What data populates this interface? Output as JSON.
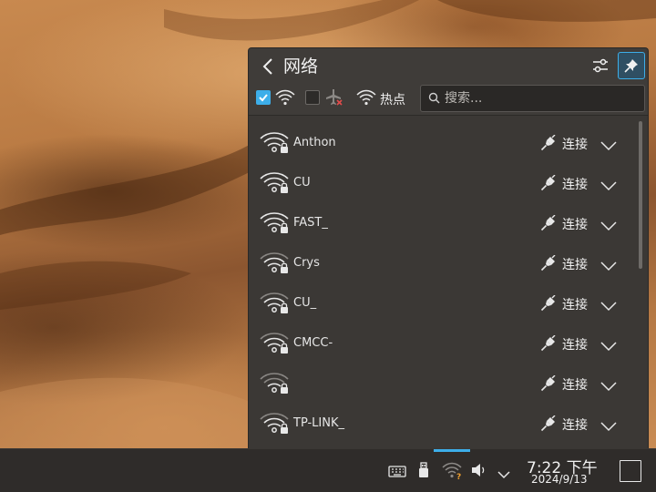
{
  "popup": {
    "title": "网络",
    "filters": {
      "wifi_enabled": true,
      "airplane_mode": false,
      "hotspot_label": "热点"
    },
    "search": {
      "placeholder": "搜索...",
      "value": ""
    },
    "networks": [
      {
        "ssid": "Anthon",
        "action": "连接",
        "secured": true,
        "signal": "strong"
      },
      {
        "ssid": "CU",
        "action": "连接",
        "secured": true,
        "signal": "strong"
      },
      {
        "ssid": "FAST_",
        "action": "连接",
        "secured": true,
        "signal": "strong"
      },
      {
        "ssid": "Crys",
        "action": "连接",
        "secured": true,
        "signal": "medium"
      },
      {
        "ssid": "CU_",
        "action": "连接",
        "secured": true,
        "signal": "medium"
      },
      {
        "ssid": "CMCC-",
        "action": "连接",
        "secured": true,
        "signal": "medium"
      },
      {
        "ssid": "",
        "action": "连接",
        "secured": true,
        "signal": "weak"
      },
      {
        "ssid": "TP-LINK_",
        "action": "连接",
        "secured": true,
        "signal": "medium"
      }
    ]
  },
  "taskbar": {
    "clock": {
      "time": "7:22 下午",
      "date": "2024/9/13"
    },
    "tray_icons": [
      "keyboard-icon",
      "usb-icon",
      "wifi-unknown-icon",
      "volume-icon",
      "chevron-up-icon",
      "show-desktop-icon"
    ]
  },
  "colors": {
    "accent": "#3daee9",
    "panel": "#3b3835",
    "taskbar": "#2f2c2a"
  }
}
